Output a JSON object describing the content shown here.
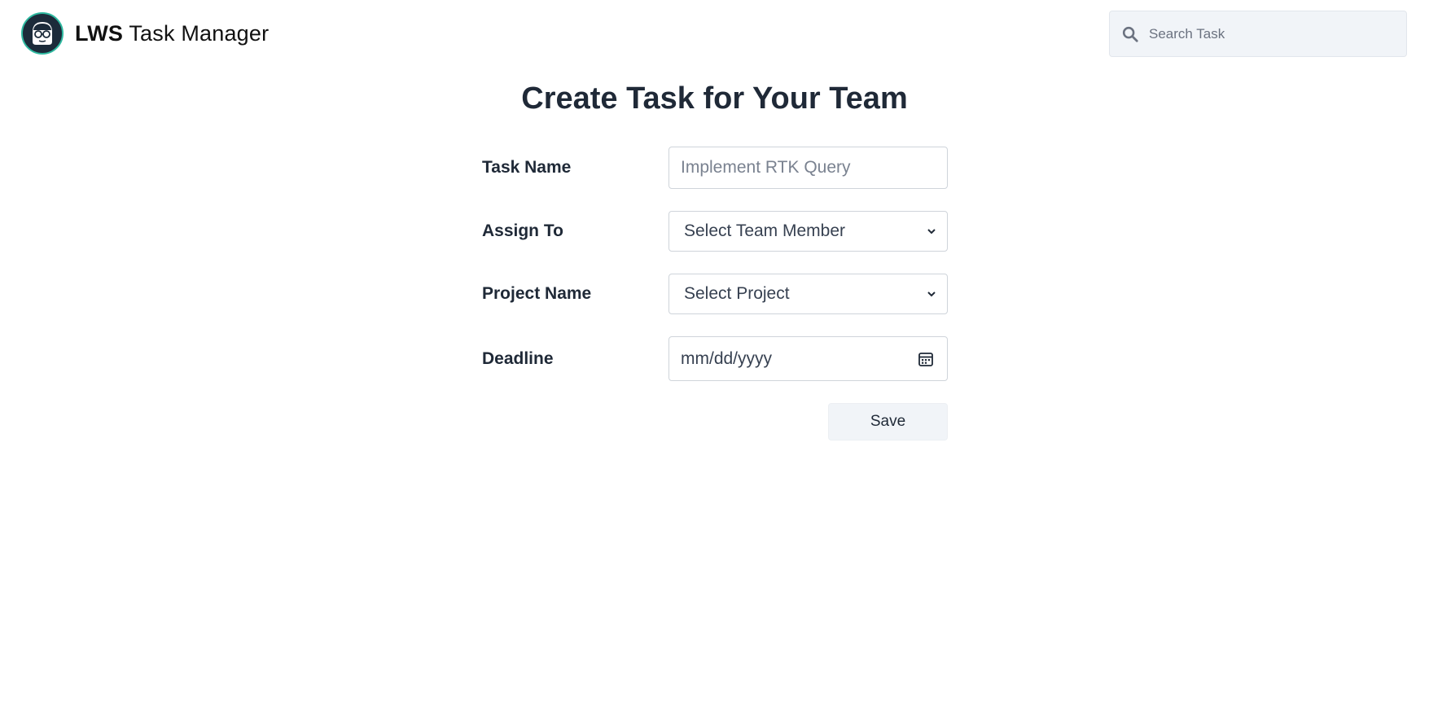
{
  "header": {
    "brand_bold": "LWS",
    "brand_rest": " Task Manager",
    "logo_icon": "avatar-glasses-icon",
    "search": {
      "placeholder": "Search Task",
      "icon": "search-icon"
    }
  },
  "page": {
    "title": "Create Task for Your Team"
  },
  "form": {
    "task_name": {
      "label": "Task Name",
      "placeholder": "Implement RTK Query"
    },
    "assign_to": {
      "label": "Assign To",
      "selected": "Select Team Member"
    },
    "project_name": {
      "label": "Project Name",
      "selected": "Select Project"
    },
    "deadline": {
      "label": "Deadline",
      "placeholder": "mm/dd/yyyy",
      "icon": "calendar-icon"
    },
    "save_label": "Save"
  },
  "colors": {
    "logo_ring": "#2fb9a0",
    "logo_bg": "#1c2b3a",
    "button_bg": "#f1f4f8"
  }
}
